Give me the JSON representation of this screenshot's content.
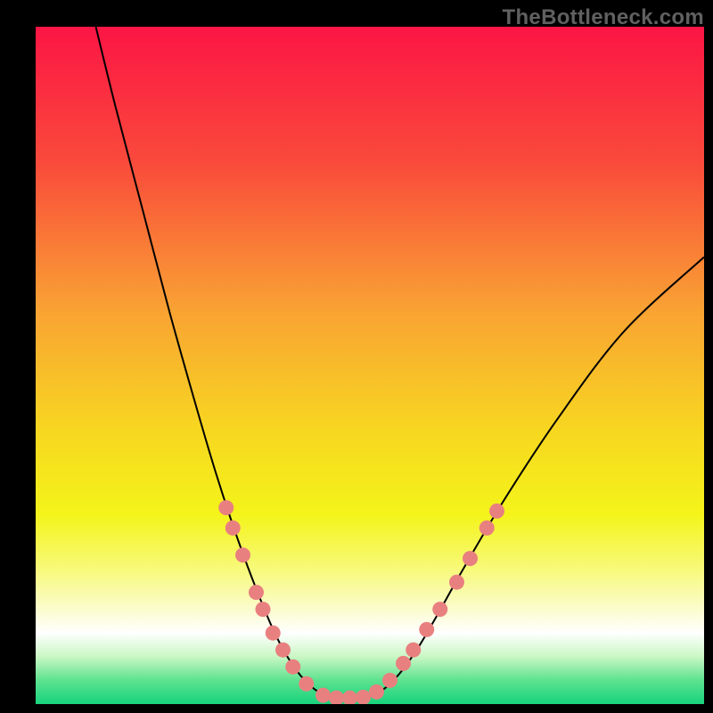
{
  "watermark": "TheBottleneck.com",
  "colors": {
    "frame": "#000000",
    "watermark": "#606060",
    "curve": "#000000",
    "dot_fill": "#e98080",
    "dot_stroke": "#c75b5b",
    "gradient_stops": [
      {
        "offset": 0.0,
        "color": "#fc1545"
      },
      {
        "offset": 0.2,
        "color": "#f94a3b"
      },
      {
        "offset": 0.42,
        "color": "#f9a333"
      },
      {
        "offset": 0.6,
        "color": "#f7d820"
      },
      {
        "offset": 0.72,
        "color": "#f4f41a"
      },
      {
        "offset": 0.8,
        "color": "#f7f979"
      },
      {
        "offset": 0.86,
        "color": "#fbfccd"
      },
      {
        "offset": 0.895,
        "color": "#ffffff"
      },
      {
        "offset": 0.93,
        "color": "#c9f7c4"
      },
      {
        "offset": 0.965,
        "color": "#5de28f"
      },
      {
        "offset": 1.0,
        "color": "#17d37d"
      }
    ]
  },
  "chart_data": {
    "type": "line",
    "title": "",
    "xlabel": "",
    "ylabel": "",
    "xlim": [
      0,
      100
    ],
    "ylim": [
      0,
      100
    ],
    "series": [
      {
        "name": "bottleneck-curve",
        "points": [
          {
            "x": 9.0,
            "y": 100.0
          },
          {
            "x": 12.0,
            "y": 88.0
          },
          {
            "x": 16.0,
            "y": 73.0
          },
          {
            "x": 20.0,
            "y": 58.0
          },
          {
            "x": 24.0,
            "y": 44.0
          },
          {
            "x": 27.0,
            "y": 34.0
          },
          {
            "x": 30.0,
            "y": 25.0
          },
          {
            "x": 33.0,
            "y": 17.0
          },
          {
            "x": 36.0,
            "y": 10.0
          },
          {
            "x": 39.0,
            "y": 5.0
          },
          {
            "x": 42.0,
            "y": 2.0
          },
          {
            "x": 45.0,
            "y": 0.8
          },
          {
            "x": 48.0,
            "y": 0.8
          },
          {
            "x": 51.0,
            "y": 1.5
          },
          {
            "x": 54.0,
            "y": 4.0
          },
          {
            "x": 57.0,
            "y": 8.0
          },
          {
            "x": 60.0,
            "y": 13.0
          },
          {
            "x": 64.0,
            "y": 20.0
          },
          {
            "x": 70.0,
            "y": 30.0
          },
          {
            "x": 78.0,
            "y": 42.0
          },
          {
            "x": 88.0,
            "y": 55.0
          },
          {
            "x": 100.0,
            "y": 66.0
          }
        ]
      }
    ],
    "dots_left": [
      {
        "x": 28.5,
        "y": 29.0
      },
      {
        "x": 29.5,
        "y": 26.0
      },
      {
        "x": 31.0,
        "y": 22.0
      },
      {
        "x": 33.0,
        "y": 16.5
      },
      {
        "x": 34.0,
        "y": 14.0
      },
      {
        "x": 35.5,
        "y": 10.5
      },
      {
        "x": 37.0,
        "y": 8.0
      },
      {
        "x": 38.5,
        "y": 5.5
      },
      {
        "x": 40.5,
        "y": 3.0
      },
      {
        "x": 43.0,
        "y": 1.3
      },
      {
        "x": 45.0,
        "y": 0.9
      },
      {
        "x": 47.0,
        "y": 0.9
      }
    ],
    "dots_right": [
      {
        "x": 49.0,
        "y": 1.0
      },
      {
        "x": 51.0,
        "y": 1.8
      },
      {
        "x": 53.0,
        "y": 3.5
      },
      {
        "x": 55.0,
        "y": 6.0
      },
      {
        "x": 56.5,
        "y": 8.0
      },
      {
        "x": 58.5,
        "y": 11.0
      },
      {
        "x": 60.5,
        "y": 14.0
      },
      {
        "x": 63.0,
        "y": 18.0
      },
      {
        "x": 65.0,
        "y": 21.5
      },
      {
        "x": 67.5,
        "y": 26.0
      },
      {
        "x": 69.0,
        "y": 28.5
      }
    ]
  }
}
